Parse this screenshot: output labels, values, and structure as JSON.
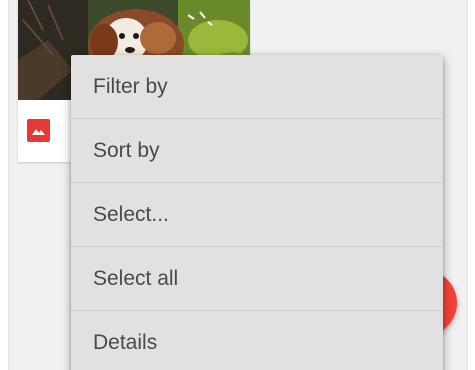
{
  "menu": {
    "items": [
      {
        "label": "Filter by"
      },
      {
        "label": "Sort by"
      },
      {
        "label": "Select..."
      },
      {
        "label": "Select all"
      },
      {
        "label": "Details"
      }
    ]
  },
  "icons": {
    "badge": "image-icon",
    "fab": "floating-action-button"
  },
  "colors": {
    "accent": "#f44336",
    "badge": "#e53935",
    "menu_background": "#e1e1e1",
    "menu_text": "#4a4a4a"
  }
}
